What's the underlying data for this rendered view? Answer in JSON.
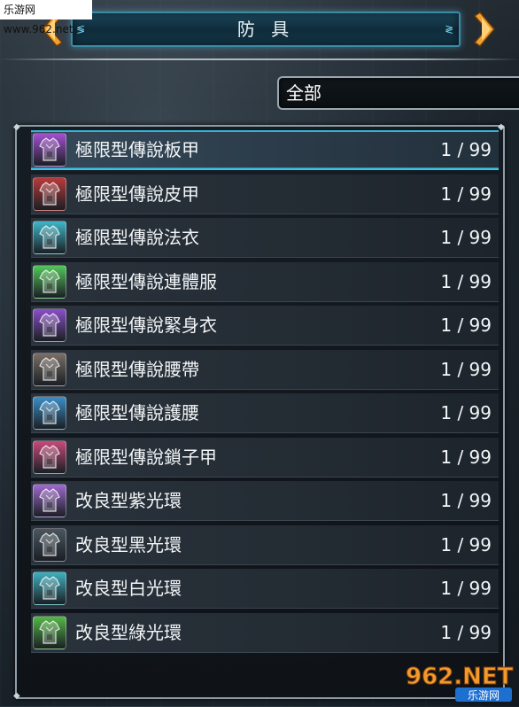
{
  "watermark_top": "乐游网 www.962.net",
  "header": {
    "title": "防 具"
  },
  "filter": {
    "selected": "全部"
  },
  "items": [
    {
      "name": "極限型傳說板甲",
      "qty": "1 / 99",
      "color": "#a24fd0"
    },
    {
      "name": "極限型傳說皮甲",
      "qty": "1 / 99",
      "color": "#b83a3a"
    },
    {
      "name": "極限型傳說法衣",
      "qty": "1 / 99",
      "color": "#3fb6c8"
    },
    {
      "name": "極限型傳說連體服",
      "qty": "1 / 99",
      "color": "#53c75a"
    },
    {
      "name": "極限型傳說緊身衣",
      "qty": "1 / 99",
      "color": "#8a4fc8"
    },
    {
      "name": "極限型傳說腰帶",
      "qty": "1 / 99",
      "color": "#7a6f66"
    },
    {
      "name": "極限型傳說護腰",
      "qty": "1 / 99",
      "color": "#3a8fc8"
    },
    {
      "name": "極限型傳說鎖子甲",
      "qty": "1 / 99",
      "color": "#c84a7a"
    },
    {
      "name": "改良型紫光環",
      "qty": "1 / 99",
      "color": "#a06ad0"
    },
    {
      "name": "改良型黑光環",
      "qty": "1 / 99",
      "color": "#4a5660"
    },
    {
      "name": "改良型白光環",
      "qty": "1 / 99",
      "color": "#3fb0bf"
    },
    {
      "name": "改良型綠光環",
      "qty": "1 / 99",
      "color": "#55b848"
    }
  ],
  "watermark_logo": {
    "main": "962.NET",
    "sub": "乐游网"
  }
}
